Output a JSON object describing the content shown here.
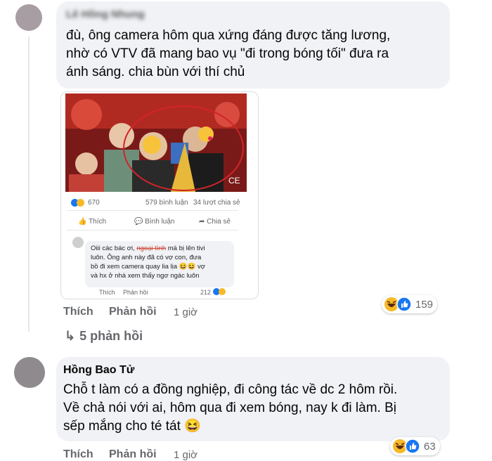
{
  "comment1": {
    "author": "Lê Hồng Nhung",
    "lines": [
      "đù, ông camera hôm qua xứng đáng được tăng lương,",
      "nhờ có VTV đã mang bao vụ \"đi trong bóng tối\" đưa ra",
      "ánh sáng. chia bùn với thí chủ"
    ],
    "actions": {
      "like": "Thích",
      "reply": "Phản hồi",
      "time": "1 giờ"
    },
    "reactions": {
      "count": "159",
      "icons": [
        "haha-icon",
        "like-icon"
      ]
    },
    "replies_link": "5 phản hồi"
  },
  "embedded_post": {
    "reaction_count": "670",
    "comments": "579 bình luận",
    "shares": "34 lượt chia sẻ",
    "buttons": {
      "like": "Thích",
      "comment": "Bình luận",
      "share": "Chia sẻ"
    },
    "quoted_comment": {
      "before": "Oiii các bác ơi, ",
      "strike": "ngoại tình",
      "after": " mà bị lên tivi",
      "lines": [
        "luôn. Ông anh này đã có vợ con, đưa",
        "bồ đi xem camera quay lia lịa 😆😆 vợ",
        "và hx ở nhà xem thấy ngơ ngác luôn"
      ],
      "like": "Thích",
      "reply": "Phản hồi",
      "count": "212"
    },
    "photo_text": "CE"
  },
  "comment2": {
    "author": "Hồng Bao Tử",
    "lines": [
      "Chỗ t làm có a đồng nghiệp, đi công tác về dc 2 hôm rồi.",
      "Về chả nói với ai, hôm qua đi xem bóng, nay k đi làm. Bị",
      "sếp mắng cho té tát 😆"
    ],
    "actions": {
      "like": "Thích",
      "reply": "Phản hồi",
      "time": "1 giờ"
    },
    "reactions": {
      "count": "63",
      "icons": [
        "haha-icon",
        "like-icon"
      ]
    }
  },
  "colors": {
    "like_blue": "#1877f2",
    "haha_yellow": "#f7b928",
    "bubble": "#f0f2f5",
    "meta": "#65676b"
  }
}
